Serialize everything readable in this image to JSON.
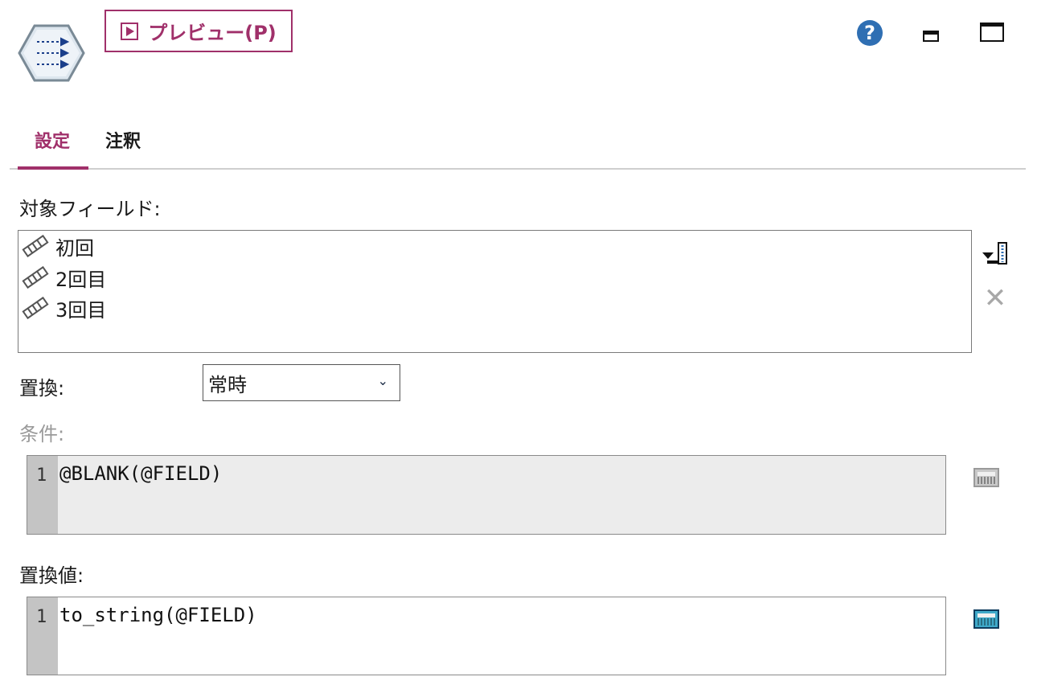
{
  "header": {
    "preview_label": "プレビュー(P)",
    "help_glyph": "?"
  },
  "tabs": [
    {
      "label": "設定",
      "active": true
    },
    {
      "label": "注釈",
      "active": false
    }
  ],
  "target_fields": {
    "label": "対象フィールド:",
    "items": [
      "初回",
      "2回目",
      "3回目"
    ]
  },
  "replace": {
    "label": "置換:",
    "selected": "常時"
  },
  "condition": {
    "label": "条件:",
    "line_number": "1",
    "code": "@BLANK(@FIELD)",
    "disabled": true
  },
  "replacement_value": {
    "label": "置換値:",
    "line_number": "1",
    "code": "to_string(@FIELD)"
  },
  "colors": {
    "accent": "#a0306a",
    "help": "#2f6fb3"
  },
  "icons": {
    "node": "filler-node-icon",
    "field": "continuous-field-icon",
    "pick": "field-picker-icon",
    "delete": "delete-icon",
    "calculator": "expression-builder-icon"
  }
}
